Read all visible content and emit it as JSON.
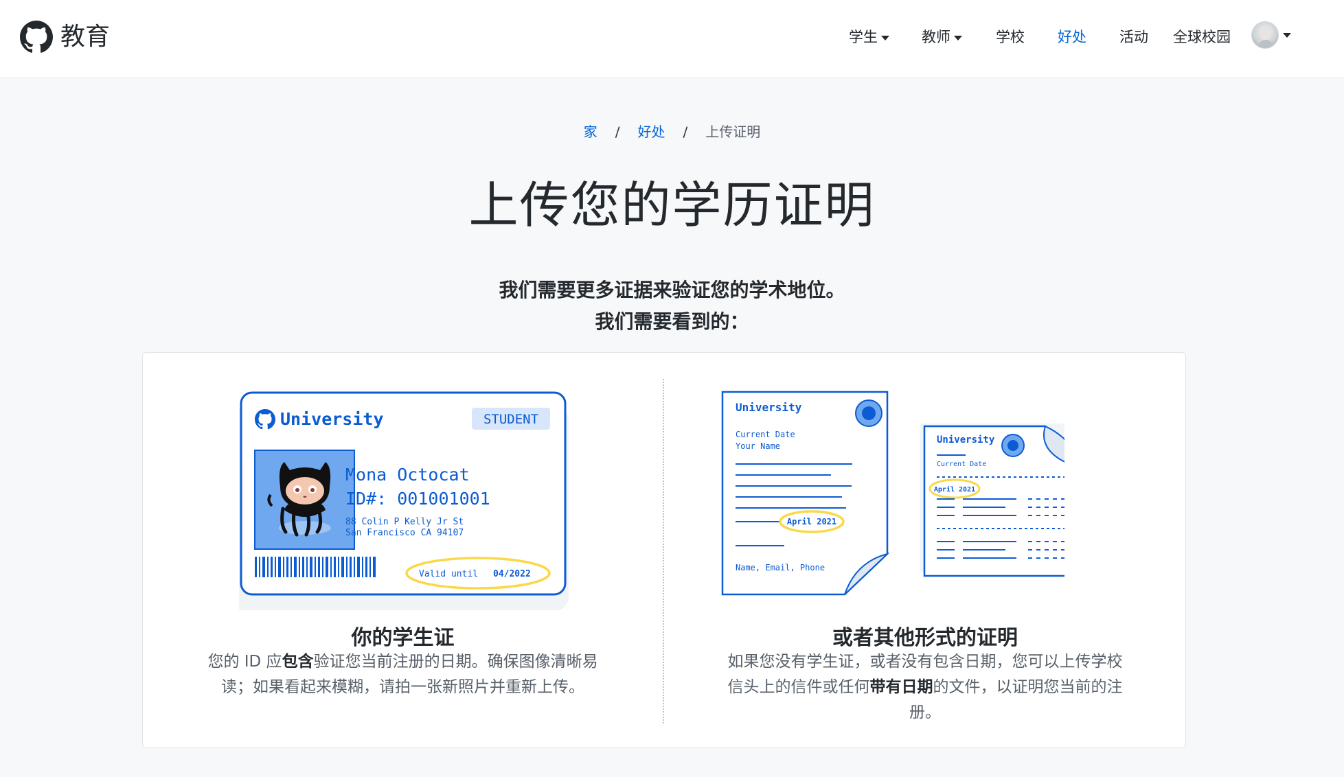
{
  "header": {
    "brand_name": "教育",
    "nav": [
      {
        "label": "学生",
        "dropdown": true
      },
      {
        "label": "教师",
        "dropdown": true
      },
      {
        "label": "学校",
        "dropdown": false
      },
      {
        "label": "好处",
        "dropdown": false,
        "active": true
      },
      {
        "label": "活动",
        "dropdown": false
      },
      {
        "label": "全球校园",
        "dropdown": false
      }
    ]
  },
  "breadcrumb": {
    "home": "家",
    "benefits": "好处",
    "current": "上传证明",
    "separator": "/"
  },
  "page_title": "上传您的学历证明",
  "lead": {
    "line1": "我们需要更多证据来验证您的学术地位。",
    "line2": "我们需要看到的："
  },
  "left": {
    "title": "你的学生证",
    "desc_before": "您的 ID 应",
    "desc_bold": "包含",
    "desc_after": "验证您当前注册的日期。确保图像清晰易读；如果看起来模糊，请拍一张新照片并重新上传。",
    "id_card": {
      "university": "University",
      "badge": "STUDENT",
      "name": "Mona Octocat",
      "id_line": "ID#: 001001001",
      "address1": "88 Colin P Kelly Jr St",
      "address2": "San Francisco CA 94107",
      "valid_label": "Valid until",
      "valid_date": "04/2022"
    }
  },
  "right": {
    "title": "或者其他形式的证明",
    "desc_before": "如果您没有学生证，或者没有包含日期，您可以上传学校信头上的信件或任何",
    "desc_bold": "带有日期",
    "desc_after": "的文件，以证明您当前的注册。",
    "doc1": {
      "university": "University",
      "current_date": "Current Date",
      "your_name": "Your Name",
      "date_stamp": "April 2021",
      "footer": "Name, Email, Phone"
    },
    "doc2": {
      "university": "University",
      "current_date": "Current Date",
      "date_stamp": "April 2021"
    }
  },
  "colors": {
    "accent": "#0366d6",
    "highlight": "#f9d84a",
    "card_blue": "#1f6feb"
  }
}
